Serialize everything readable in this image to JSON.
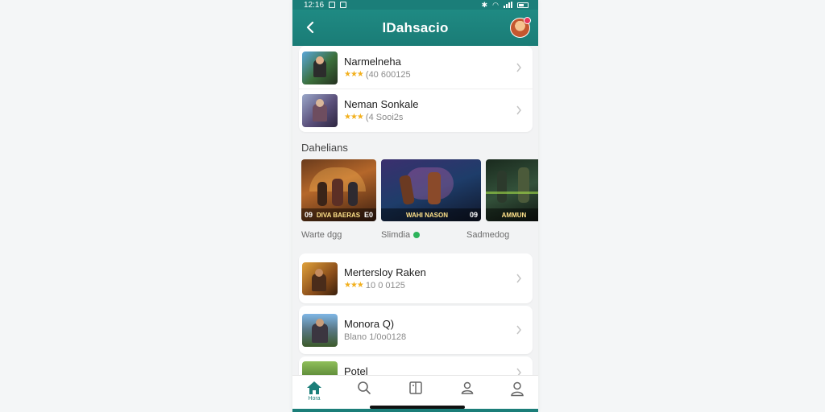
{
  "status_bar": {
    "time": "12:16"
  },
  "app_bar": {
    "title": "lDahsacio"
  },
  "top_list": [
    {
      "title": "Narmelneha",
      "stars": "★★★",
      "meta": "(40 600125"
    },
    {
      "title": "Neman Sonkale",
      "stars": "★★★",
      "meta": "(4 Sooi2s"
    }
  ],
  "section": {
    "title": "Dahelians",
    "tiles": [
      {
        "left_mark": "09",
        "caption": "DIVA BAERAS",
        "right_mark": "E0",
        "label": "Warte dgg"
      },
      {
        "left_mark": "",
        "caption": "WAHI NASON",
        "right_mark": "09",
        "label": "Slimdia"
      },
      {
        "left_mark": "",
        "caption": "AMMUN",
        "right_mark": "",
        "label": "Sadmedog"
      }
    ]
  },
  "bottom_list": [
    {
      "title": "Mertersloy Raken",
      "stars": "★★★",
      "meta": "10 0 0125"
    },
    {
      "title": "Monora Q)",
      "stars": "",
      "meta": "Blano 1/0o0128"
    },
    {
      "title": "Potel",
      "stars": "",
      "meta": ""
    }
  ],
  "bottom_nav": {
    "home_label": "Hora"
  },
  "colors": {
    "primary": "#1b7e79",
    "star": "#f2b01e",
    "badge": "#e8395a"
  }
}
